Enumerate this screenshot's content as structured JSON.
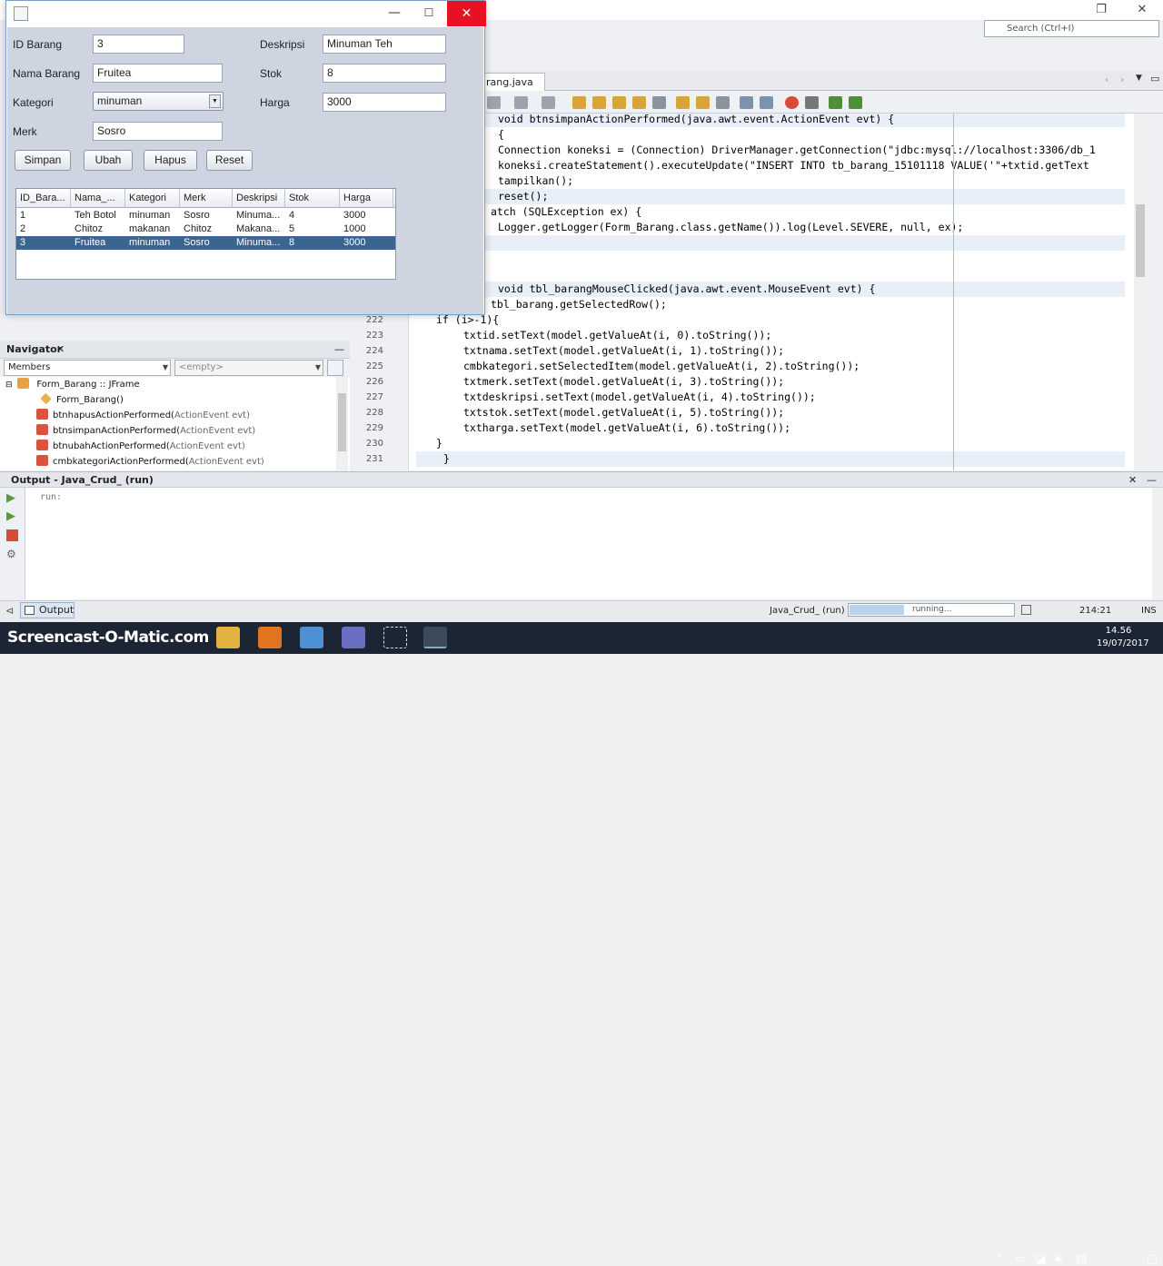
{
  "ide": {
    "editor_tab": "rang.java",
    "search_placeholder": "Search (Ctrl+I)",
    "code_lines": [
      {
        "n": "",
        "t": "void btnsimpanActionPerformed(java.awt.event.ActionEvent evt) {"
      },
      {
        "n": "",
        "t": "{"
      },
      {
        "n": "",
        "t": "Connection koneksi = (Connection) DriverManager.getConnection(\"jdbc:mysql://localhost:3306/db_1"
      },
      {
        "n": "",
        "t": "koneksi.createStatement().executeUpdate(\"INSERT INTO tb_barang_15101118 VALUE('\"+txtid.getText"
      },
      {
        "n": "",
        "t": "tampilkan();"
      },
      {
        "n": "",
        "t": "reset();"
      },
      {
        "n": "",
        "t": "atch (SQLException ex) {"
      },
      {
        "n": "",
        "t": "Logger.getLogger(Form_Barang.class.getName()).log(Level.SEVERE, null, ex);"
      },
      {
        "n": "",
        "t": ""
      },
      {
        "n": "",
        "t": ""
      },
      {
        "n": "",
        "t": ""
      },
      {
        "n": "",
        "t": "void tbl_barangMouseClicked(java.awt.event.MouseEvent evt) {"
      },
      {
        "n": "",
        "t": "tbl_barang.getSelectedRow();"
      },
      {
        "n": "222",
        "t": "if (i>-1){"
      },
      {
        "n": "223",
        "t": "txtid.setText(model.getValueAt(i, 0).toString());"
      },
      {
        "n": "224",
        "t": "txtnama.setText(model.getValueAt(i, 1).toString());"
      },
      {
        "n": "225",
        "t": "cmbkategori.setSelectedItem(model.getValueAt(i, 2).toString());"
      },
      {
        "n": "226",
        "t": "txtmerk.setText(model.getValueAt(i, 3).toString());"
      },
      {
        "n": "227",
        "t": "txtdeskripsi.setText(model.getValueAt(i, 4).toString());"
      },
      {
        "n": "228",
        "t": "txtstok.setText(model.getValueAt(i, 5).toString());"
      },
      {
        "n": "229",
        "t": "txtharga.setText(model.getValueAt(i, 6).toString());"
      },
      {
        "n": "230",
        "t": "}"
      },
      {
        "n": "231",
        "t": "}"
      }
    ],
    "navigator": {
      "title": "Navigator",
      "members_label": "Members",
      "filter_placeholder": "<empty>",
      "root": "Form_Barang :: JFrame",
      "items": [
        {
          "name": "Form_Barang()",
          "param": ""
        },
        {
          "name": "btnhapusActionPerformed(",
          "param": "ActionEvent evt)"
        },
        {
          "name": "btnsimpanActionPerformed(",
          "param": "ActionEvent evt)"
        },
        {
          "name": "btnubahActionPerformed(",
          "param": "ActionEvent evt)"
        },
        {
          "name": "cmbkategoriActionPerformed(",
          "param": "ActionEvent evt)"
        }
      ]
    },
    "output": {
      "title": "Output - Java_Crud_ (run)",
      "text": "run:",
      "tab_label": "Output"
    },
    "status": {
      "project": "Java_Crud_ (run)",
      "progress_text": "running...",
      "progress_value": 0.33,
      "position": "214:21",
      "mode": "INS"
    }
  },
  "taskbar": {
    "watermark": "Screencast-O-Matic.com",
    "time": "14.56",
    "date": "19/07/2017"
  },
  "form": {
    "labels": {
      "id": "ID Barang",
      "nama": "Nama Barang",
      "kategori": "Kategori",
      "merk": "Merk",
      "deskripsi": "Deskripsi",
      "stok": "Stok",
      "harga": "Harga"
    },
    "values": {
      "id": "3",
      "nama": "Fruitea",
      "kategori": "minuman",
      "merk": "Sosro",
      "deskripsi": "Minuman Teh",
      "stok": "8",
      "harga": "3000"
    },
    "buttons": {
      "simpan": "Simpan",
      "ubah": "Ubah",
      "hapus": "Hapus",
      "reset": "Reset"
    },
    "table": {
      "headers": [
        "ID_Bara...",
        "Nama_...",
        "Kategori",
        "Merk",
        "Deskripsi",
        "Stok",
        "Harga"
      ],
      "rows": [
        [
          "1",
          "Teh Botol",
          "minuman",
          "Sosro",
          "Minuma...",
          "4",
          "3000"
        ],
        [
          "2",
          "Chitoz",
          "makanan",
          "Chitoz",
          "Makana...",
          "5",
          "1000"
        ],
        [
          "3",
          "Fruitea",
          "minuman",
          "Sosro",
          "Minuma...",
          "8",
          "3000"
        ]
      ],
      "selected_row": 2
    }
  },
  "colors": {
    "close": "#e81123",
    "selection": "#3b6591",
    "taskbar": "#1c2533"
  }
}
